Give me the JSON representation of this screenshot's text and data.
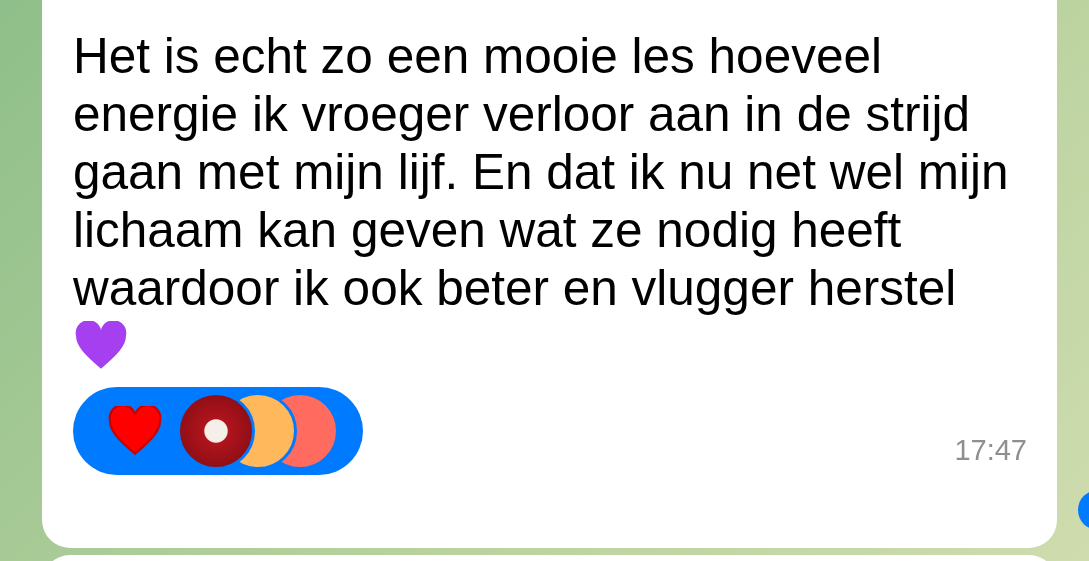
{
  "message": {
    "text": "Het is echt zo een mooie les hoeveel energie ik vroeger verloor aan in de strijd gaan met mijn lijf. En dat ik nu net wel mijn lichaam kan geven wat ze nodig heeft waardoor ik ook beter en vlugger herstel",
    "reaction": {
      "selected": true,
      "avatars": [
        {
          "kind": "photo"
        },
        {
          "kind": "color",
          "color": "#ffb85c"
        },
        {
          "kind": "color",
          "color": "#ff6b5e"
        }
      ]
    },
    "time": "17:47"
  }
}
